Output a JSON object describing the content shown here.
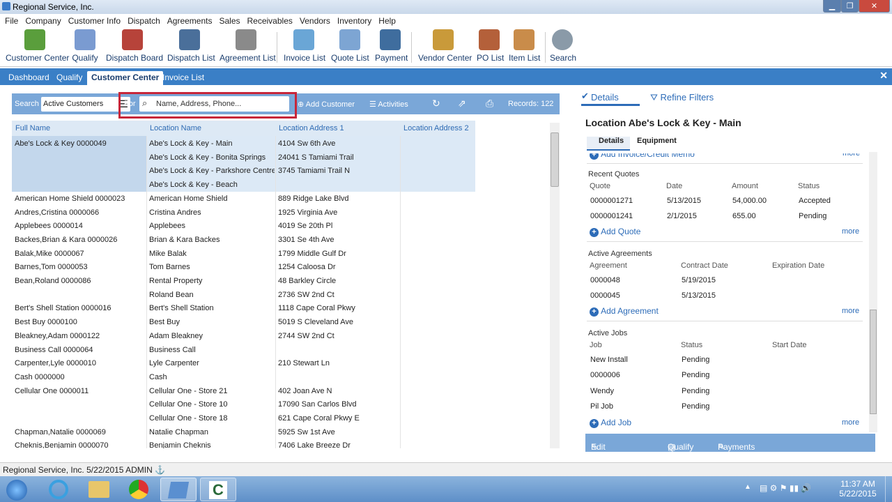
{
  "window": {
    "title": "Regional Service, Inc."
  },
  "menu": [
    "File",
    "Company",
    "Customer Info",
    "Dispatch",
    "Agreements",
    "Sales",
    "Receivables",
    "Vendors",
    "Inventory",
    "Help"
  ],
  "toolbar": [
    {
      "label": "Customer Center",
      "icon": "customer-center-icon",
      "color": "#5a9e3c"
    },
    {
      "label": "Qualify",
      "icon": "qualify-icon",
      "color": "#7a9bd1"
    },
    {
      "label": "Dispatch Board",
      "icon": "dispatch-board-icon",
      "color": "#b7433a"
    },
    {
      "label": "Dispatch List",
      "icon": "dispatch-list-icon",
      "color": "#4a6f9a"
    },
    {
      "label": "Agreement List",
      "icon": "agreement-list-icon",
      "color": "#8a8a8a"
    },
    {
      "label": "Invoice List",
      "icon": "invoice-list-icon",
      "color": "#6aa6d6"
    },
    {
      "label": "Quote List",
      "icon": "quote-list-icon",
      "color": "#7da5d3"
    },
    {
      "label": "Payment",
      "icon": "payment-icon",
      "color": "#3f6d9e"
    },
    {
      "label": "Vendor Center",
      "icon": "vendor-center-icon",
      "color": "#c99a3a"
    },
    {
      "label": "PO List",
      "icon": "po-list-icon",
      "color": "#b4603a"
    },
    {
      "label": "Item List",
      "icon": "item-list-icon",
      "color": "#c98c4a"
    },
    {
      "label": "Search",
      "icon": "search-icon",
      "color": "#8a9aa8"
    }
  ],
  "tabs": [
    "Dashboard",
    "Qualify",
    "Customer Center",
    "Invoice List"
  ],
  "search": {
    "label": "Search",
    "scope": "Active Customers",
    "for_label": "For",
    "placeholder": "Name, Address, Phone...",
    "add_customer": "Add Customer",
    "activities": "Activities",
    "records": "Records: 122"
  },
  "grid": {
    "headers": [
      "Full Name",
      "Location Name",
      "Location Address 1",
      "Location Address 2"
    ],
    "rows": [
      [
        "Abe's Lock & Key 0000049",
        "Abe's Lock & Key - Main",
        "4104 Sw 6th Ave",
        ""
      ],
      [
        "",
        "Abe's Lock & Key - Bonita Springs",
        "24041 S Tamiami Trail",
        ""
      ],
      [
        "",
        "Abe's Lock & Key - Parkshore Centre",
        "3745 Tamiami Trail N",
        ""
      ],
      [
        "",
        "Abe's Lock & Key - Beach",
        "",
        ""
      ],
      [
        "American Home Shield 0000023",
        "American Home Shield",
        "889 Ridge Lake Blvd",
        ""
      ],
      [
        "Andres,Cristina 0000066",
        "Cristina Andres",
        "1925 Virginia Ave",
        ""
      ],
      [
        "Applebees 0000014",
        "Applebees",
        "4019 Se 20th Pl",
        ""
      ],
      [
        "Backes,Brian & Kara 0000026",
        "Brian & Kara Backes",
        "3301 Se 4th Ave",
        ""
      ],
      [
        "Balak,Mike 0000067",
        "Mike Balak",
        "1799 Middle Gulf Dr",
        ""
      ],
      [
        "Barnes,Tom 0000053",
        "Tom Barnes",
        "1254 Caloosa Dr",
        ""
      ],
      [
        "Bean,Roland 0000086",
        "Rental Property",
        "48 Barkley Circle",
        ""
      ],
      [
        "",
        "Roland Bean",
        "2736 SW 2nd Ct",
        ""
      ],
      [
        "Bert's Shell Station 0000016",
        "Bert's Shell Station",
        "1118 Cape Coral Pkwy",
        ""
      ],
      [
        "Best Buy 0000100",
        "Best Buy",
        "5019 S Cleveland Ave",
        ""
      ],
      [
        "Bleakney,Adam 0000122",
        "Adam Bleakney",
        "2744 SW 2nd Ct",
        ""
      ],
      [
        "Business Call 0000064",
        "Business Call",
        "",
        ""
      ],
      [
        "Carpenter,Lyle 0000010",
        "Lyle Carpenter",
        "210 Stewart Ln",
        ""
      ],
      [
        "Cash 0000000",
        "Cash",
        "",
        ""
      ],
      [
        "Cellular One 0000011",
        "Cellular One - Store 21",
        "402 Joan Ave N",
        ""
      ],
      [
        "",
        "Cellular One - Store 10",
        "17090 San Carlos Blvd",
        ""
      ],
      [
        "",
        "Cellular One - Store 18",
        "621 Cape Coral Pkwy E",
        ""
      ],
      [
        "Chapman,Natalie 0000069",
        "Natalie Chapman",
        "5925 Sw 1st Ave",
        ""
      ],
      [
        "Cheknis,Benjamin 0000070",
        "Benjamin Cheknis",
        "7406 Lake Breeze Dr",
        ""
      ]
    ]
  },
  "right": {
    "tabs": [
      "Details",
      "Refine Filters"
    ],
    "title": "Location Abe's Lock & Key - Main",
    "subtabs": [
      "Details",
      "Equipment"
    ],
    "cut_link": "Add Invoice/Credit Memo",
    "more": "more",
    "quotes": {
      "title": "Recent Quotes",
      "headers": [
        "Quote",
        "Date",
        "Amount",
        "Status"
      ],
      "rows": [
        [
          "0000001271",
          "5/13/2015",
          "54,000.00",
          "Accepted"
        ],
        [
          "0000001241",
          "2/1/2015",
          "655.00",
          "Pending"
        ]
      ],
      "add": "Add Quote"
    },
    "agreements": {
      "title": "Active Agreements",
      "headers": [
        "Agreement",
        "Contract Date",
        "Expiration Date"
      ],
      "rows": [
        [
          "0000048",
          "5/19/2015",
          ""
        ],
        [
          "0000045",
          "5/13/2015",
          ""
        ]
      ],
      "add": "Add Agreement"
    },
    "jobs": {
      "title": "Active Jobs",
      "headers": [
        "Job",
        "Status",
        "Start Date"
      ],
      "rows": [
        [
          "New Install",
          "Pending",
          ""
        ],
        [
          "0000006",
          "Pending",
          ""
        ],
        [
          "Wendy",
          "Pending",
          ""
        ],
        [
          "Pil Job",
          "Pending",
          ""
        ]
      ],
      "add": "Add Job"
    },
    "actions": [
      "Edit Customer",
      "Qualify",
      "Payments"
    ]
  },
  "status": {
    "company": "Regional Service, Inc.",
    "date": "5/22/2015",
    "user": "ADMIN"
  },
  "clock": {
    "time": "11:37 AM",
    "date": "5/22/2015"
  }
}
